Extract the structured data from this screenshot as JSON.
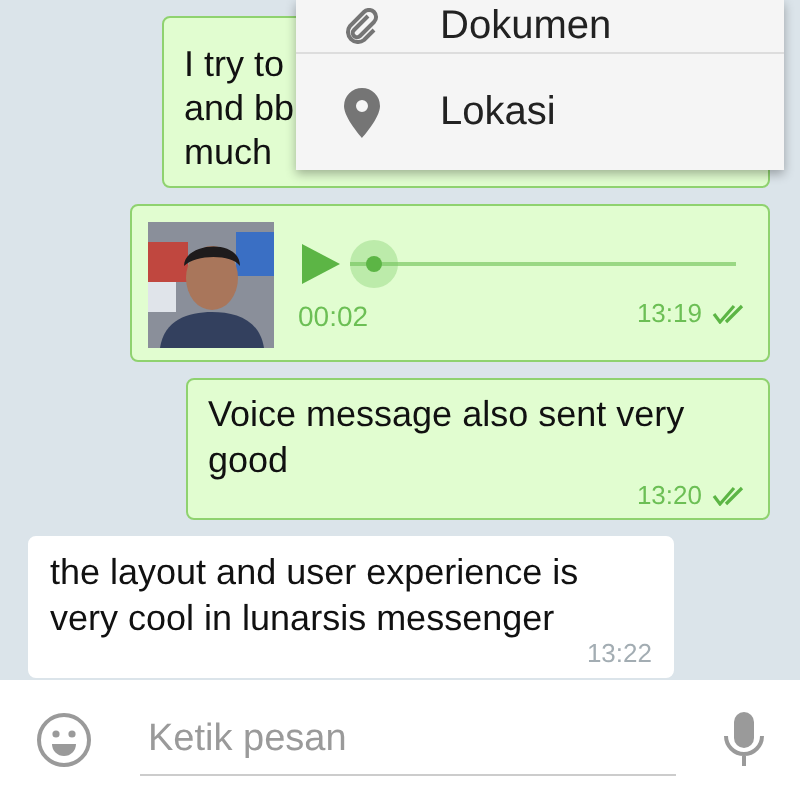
{
  "menu": {
    "items": [
      {
        "label": "Dokumen",
        "kind": "attach"
      },
      {
        "label": "Lokasi",
        "kind": "location"
      }
    ]
  },
  "messages": [
    {
      "kind": "text",
      "outgoing": true,
      "lines": [
        "I try to",
        "and bb",
        "much"
      ]
    },
    {
      "kind": "voice",
      "outgoing": true,
      "duration": "00:02",
      "time": "13:19",
      "read": true,
      "level": 0
    },
    {
      "kind": "text",
      "outgoing": true,
      "lines": [
        "Voice message also sent very good"
      ],
      "time": "13:20",
      "read": true
    },
    {
      "kind": "text",
      "outgoing": false,
      "lines": [
        "the layout and user experience is very cool in lunarsis messenger"
      ],
      "time": "13:22"
    }
  ],
  "composer": {
    "placeholder": "Ketik pesan"
  }
}
